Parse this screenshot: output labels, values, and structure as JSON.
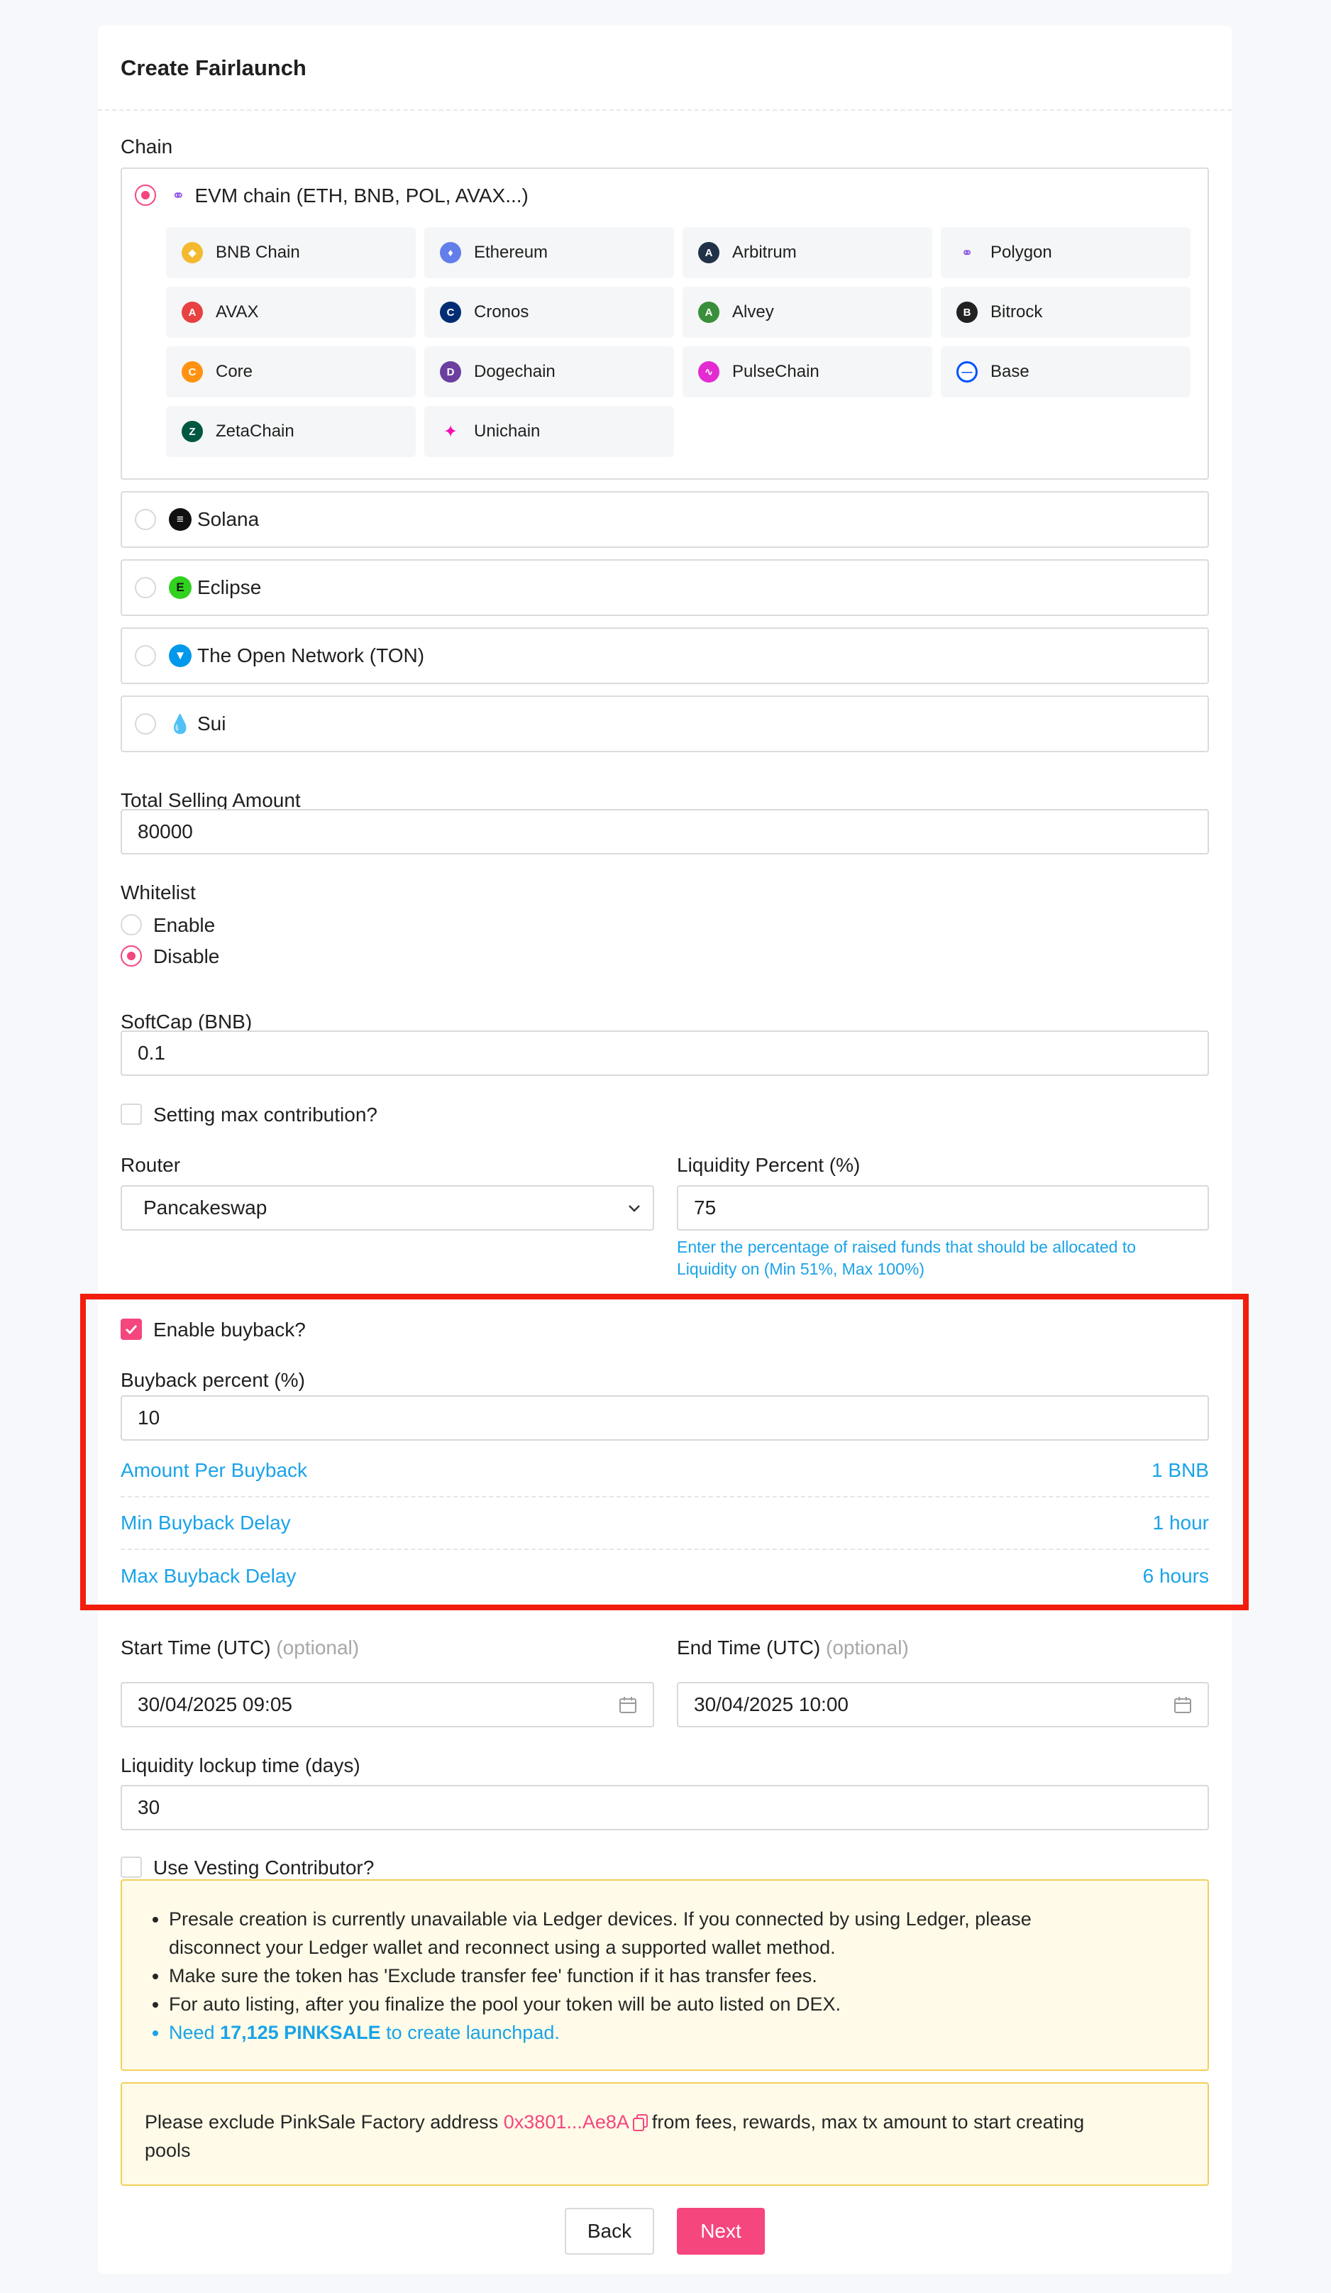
{
  "page": {
    "title": "Create Fairlaunch"
  },
  "chain": {
    "label": "Chain",
    "evm_label": "EVM chain (ETH, BNB, POL, AVAX...)",
    "evm_chains": [
      {
        "label": "BNB Chain",
        "icon": "bnb-icon",
        "color": "#f3ba2f"
      },
      {
        "label": "Ethereum",
        "icon": "ethereum-icon",
        "color": "#627eea"
      },
      {
        "label": "Arbitrum",
        "icon": "arbitrum-icon",
        "color": "#213147"
      },
      {
        "label": "Polygon",
        "icon": "polygon-icon",
        "color": "#8247e5"
      },
      {
        "label": "AVAX",
        "icon": "avax-icon",
        "color": "#e84142"
      },
      {
        "label": "Cronos",
        "icon": "cronos-icon",
        "color": "#002d74"
      },
      {
        "label": "Alvey",
        "icon": "alvey-icon",
        "color": "#3a8f3a"
      },
      {
        "label": "Bitrock",
        "icon": "bitrock-icon",
        "color": "#222222"
      },
      {
        "label": "Core",
        "icon": "core-icon",
        "color": "#ff9211"
      },
      {
        "label": "Dogechain",
        "icon": "dogechain-icon",
        "color": "#6b3fa0"
      },
      {
        "label": "PulseChain",
        "icon": "pulsechain-icon",
        "color": "#e32bd1"
      },
      {
        "label": "Base",
        "icon": "base-icon",
        "color": "#0052ff"
      },
      {
        "label": "ZetaChain",
        "icon": "zetachain-icon",
        "color": "#005741"
      },
      {
        "label": "Unichain",
        "icon": "unichain-icon",
        "color": "#f50db4"
      }
    ],
    "other_chains": [
      {
        "label": "Solana",
        "icon": "solana-icon",
        "color": "#111111"
      },
      {
        "label": "Eclipse",
        "icon": "eclipse-icon",
        "color": "#31d11f"
      },
      {
        "label": "The Open Network (TON)",
        "icon": "ton-icon",
        "color": "#0098ea"
      },
      {
        "label": "Sui",
        "icon": "sui-icon",
        "color": "#4da2ff"
      }
    ]
  },
  "total_selling": {
    "label": "Total Selling Amount",
    "value": "80000"
  },
  "whitelist": {
    "label": "Whitelist",
    "enable": "Enable",
    "disable": "Disable",
    "selected": "Disable"
  },
  "softcap": {
    "label": "SoftCap (BNB)",
    "value": "0.1"
  },
  "max_contribution": {
    "label": "Setting max contribution?",
    "checked": false
  },
  "router": {
    "label": "Router",
    "value": "Pancakeswap"
  },
  "liquidity": {
    "label": "Liquidity Percent (%)",
    "value": "75",
    "hint_line1": "Enter the percentage of raised funds that should be allocated to",
    "hint_line2": "Liquidity on (Min 51%, Max 100%)"
  },
  "buyback": {
    "enable_label": "Enable buyback?",
    "enabled": true,
    "percent_label": "Buyback percent (%)",
    "percent_value": "10",
    "rows": [
      {
        "label": "Amount Per Buyback",
        "value": "1 BNB"
      },
      {
        "label": "Min Buyback Delay",
        "value": "1 hour"
      },
      {
        "label": "Max Buyback Delay",
        "value": "6 hours"
      }
    ]
  },
  "start_time": {
    "label": "Start Time (UTC)",
    "optional": "(optional)",
    "value": "30/04/2025 09:05"
  },
  "end_time": {
    "label": "End Time (UTC)",
    "optional": "(optional)",
    "value": "30/04/2025 10:00"
  },
  "lockup": {
    "label": "Liquidity lockup time (days)",
    "value": "30"
  },
  "vesting": {
    "label": "Use Vesting Contributor?",
    "checked": false
  },
  "notice1": {
    "line1a": "Presale creation is currently unavailable via Ledger devices. If you connected by using Ledger, please",
    "line1b": "disconnect your Ledger wallet and reconnect using a supported wallet method.",
    "line2": "Make sure the token has 'Exclude transfer fee' function if it has transfer fees.",
    "line3": "For auto listing, after you finalize the pool your token will be auto listed on DEX.",
    "line4_pre": "Need ",
    "line4_amount": "17,125 PINKSALE",
    "line4_post": " to create launchpad."
  },
  "notice2": {
    "pre": "Please exclude PinkSale Factory address ",
    "address": "0x3801...Ae8A",
    "post": "from fees, rewards, max tx amount to start creating",
    "line2": "pools"
  },
  "buttons": {
    "back": "Back",
    "next": "Next"
  },
  "colors": {
    "accent": "#f5467e",
    "link": "#1aa3e8",
    "highlight": "#f21d0c"
  }
}
